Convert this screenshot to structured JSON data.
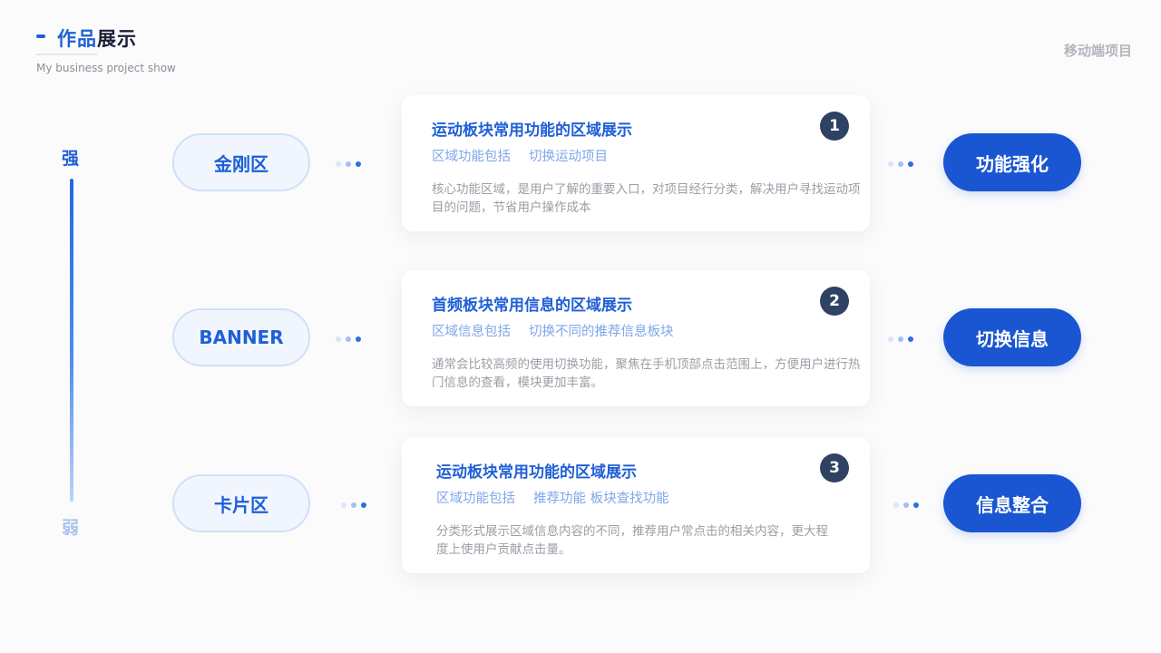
{
  "header": {
    "title_accent": "作品",
    "title_rest": "展示",
    "subtitle": "My business project show",
    "right_label": "移动端项目"
  },
  "scale": {
    "top": "强",
    "bottom": "弱"
  },
  "rows": [
    {
      "left_label": "金刚区",
      "right_label": "功能强化",
      "number": "1",
      "title": "运动板块常用功能的区域展示",
      "tags": [
        "区域功能包括",
        "切换运动项目"
      ],
      "desc": "核心功能区域，是用户了解的重要入口，对项目经行分类，解决用户寻找运动项目的问题，节省用户操作成本"
    },
    {
      "left_label": "BANNER",
      "right_label": "切换信息",
      "number": "2",
      "title": "首频板块常用信息的区域展示",
      "tags": [
        "区域信息包括",
        "切换不同的推荐信息板块"
      ],
      "desc": "通常会比较高频的使用切换功能，聚焦在手机顶部点击范围上，方便用户进行热门信息的查看，模块更加丰富。"
    },
    {
      "left_label": "卡片区",
      "right_label": "信息整合",
      "number": "3",
      "title": "运动板块常用功能的区域展示",
      "tags": [
        "区域功能包括",
        "推荐功能  板块查找功能"
      ],
      "desc": "分类形式展示区域信息内容的不同，推荐用户常点击的相关内容，更大程度上使用户贡献点击量。"
    }
  ]
}
